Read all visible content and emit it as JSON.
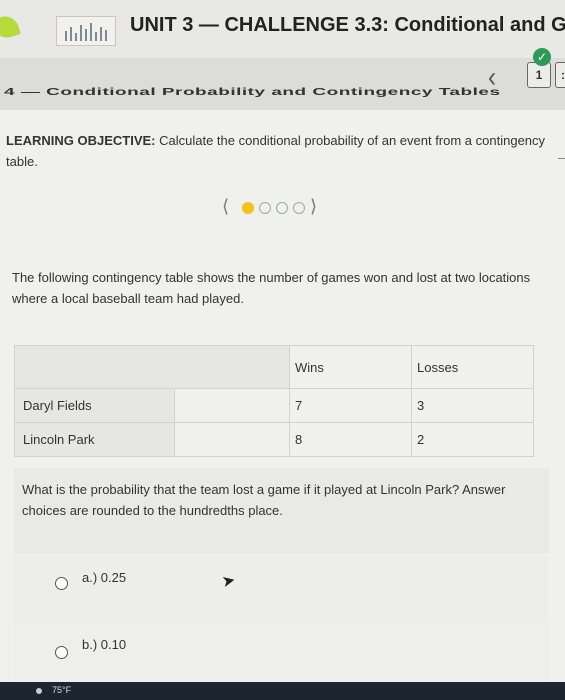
{
  "header": {
    "unit_title": "UNIT 3 — CHALLENGE 3.3: Conditional and G"
  },
  "subbar": {
    "lesson_title": "4 — Conditional Probability and Contingency Tables",
    "prev_icon": "chevron-left-icon",
    "page_number": "1",
    "next_page": ":",
    "complete_icon": "check-icon"
  },
  "objective": {
    "label": "LEARNING OBJECTIVE:",
    "text": " Calculate the conditional probability of an event from a contingency table."
  },
  "steps": {
    "total": 4,
    "current": 1,
    "left_icon": "chevron-left-icon",
    "right_icon": "chevron-right-icon"
  },
  "prompt": "The following contingency table shows the number of games won and lost at two locations where a local baseball team had played.",
  "table": {
    "headers": [
      "",
      "Wins",
      "Losses"
    ],
    "rows": [
      {
        "location": "Daryl Fields",
        "wins": "7",
        "losses": "3"
      },
      {
        "location": "Lincoln Park",
        "wins": "8",
        "losses": "2"
      }
    ]
  },
  "question": "What is the probability that the team lost a game if it played at Lincoln Park? Answer choices are rounded to the hundredths place.",
  "choices": [
    {
      "label": "a.) 0.25"
    },
    {
      "label": "b.) 0.10"
    }
  ],
  "taskbar": {
    "weather": "75°F"
  },
  "colors": {
    "accent": "#f2c21b",
    "brand_green": "#b6d93b",
    "check_green": "#2f9a58"
  }
}
